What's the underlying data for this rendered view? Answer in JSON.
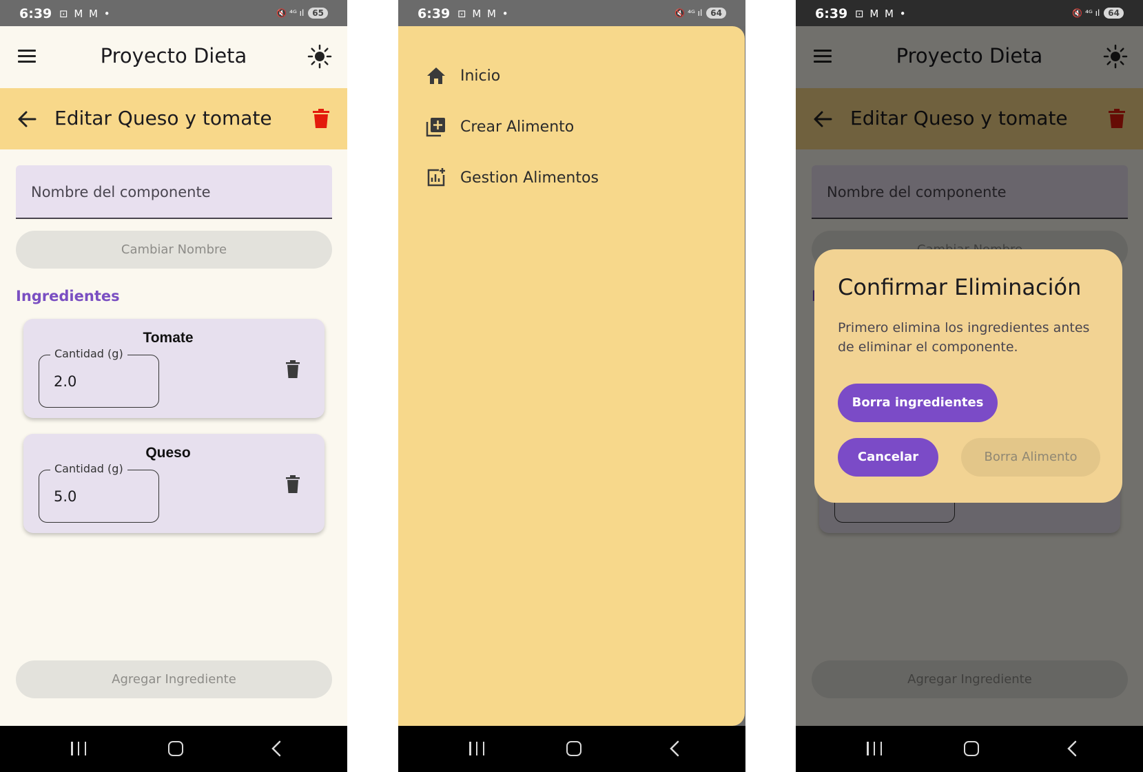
{
  "status_bars": [
    {
      "time": "6:39",
      "left_icons": "⊡ M M •",
      "right_icons": "🔇 ⁴ᴳ ıl",
      "battery": "65"
    },
    {
      "time": "6:39",
      "left_icons": "⊡ M M •",
      "right_icons": "🔇 ⁴ᴳ ıl",
      "battery": "64"
    },
    {
      "time": "6:39",
      "left_icons": "⊡ M M •",
      "right_icons": "🔇 ⁴ᴳ ıl",
      "battery": "64"
    }
  ],
  "app": {
    "title": "Proyecto Dieta",
    "edit_title": "Editar Queso y tomate"
  },
  "form": {
    "name_placeholder": "Nombre del componente",
    "rename_label": "Cambiar Nombre",
    "ingredients_heading": "Ingredientes",
    "add_ingredient_label": "Agregar Ingrediente"
  },
  "ingredients": [
    {
      "name": "Tomate",
      "qty_label": "Cantidad (g)",
      "qty_value": "2.0"
    },
    {
      "name": "Queso",
      "qty_label": "Cantidad (g)",
      "qty_value": "5.0"
    }
  ],
  "drawer": {
    "items": [
      {
        "label": "Inicio",
        "icon": "home-icon"
      },
      {
        "label": "Crear Alimento",
        "icon": "add-box-icon"
      },
      {
        "label": "Gestion Alimentos",
        "icon": "chart-add-icon"
      }
    ]
  },
  "dialog": {
    "title": "Confirmar Eliminación",
    "message": "Primero elimina los ingredientes antes de eliminar el componente.",
    "delete_ingredients_label": "Borra ingredientes",
    "cancel_label": "Cancelar",
    "delete_food_label": "Borra Alimento"
  },
  "colors": {
    "accent": "#7b4bc7",
    "sub_bar": "#f8d88a",
    "drawer": "#f7d88b",
    "delete_red": "#e31b0c",
    "background": "#fbf8ef"
  }
}
